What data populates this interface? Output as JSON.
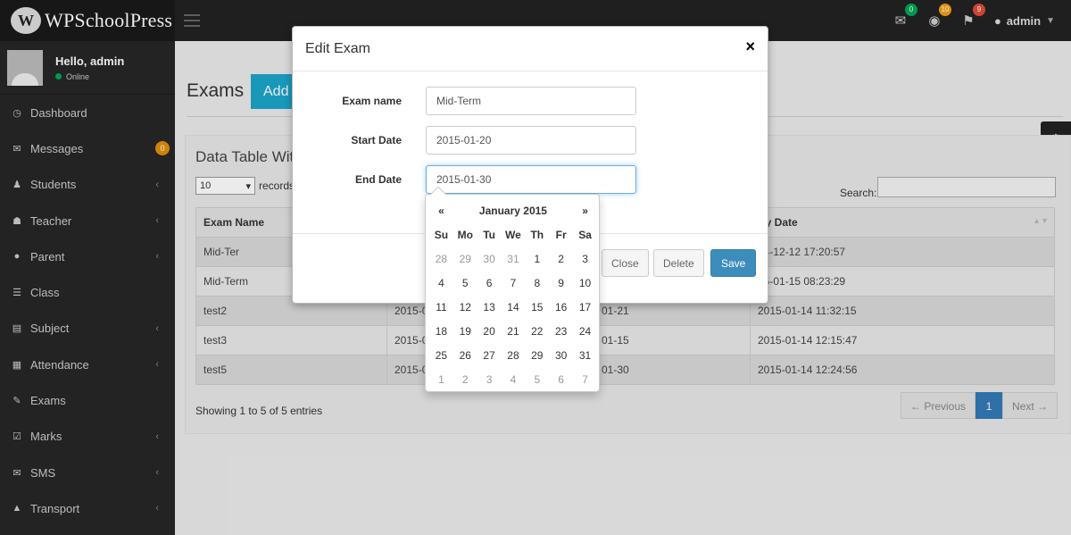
{
  "app": {
    "logo_text": "WPSchoolPress",
    "logo_mark": "W"
  },
  "header": {
    "icons": [
      {
        "name": "envelope-icon",
        "glyph": "✉",
        "badge": "0",
        "badge_color": "#00a65a"
      },
      {
        "name": "globe-icon",
        "glyph": "◉",
        "badge": "10",
        "badge_color": "#f39c12"
      },
      {
        "name": "bell-icon",
        "glyph": "🔔",
        "badge": "9",
        "badge_color": "#dd4b39"
      }
    ],
    "user": "admin"
  },
  "sidebar": {
    "greeting": "Hello, admin",
    "status": "Online",
    "items": [
      {
        "label": "Dashboard",
        "icon": "dashboard-icon",
        "glyph": "◷",
        "chevron": false
      },
      {
        "label": "Messages",
        "icon": "envelope-icon",
        "glyph": "✉",
        "chevron": false,
        "badge": "0"
      },
      {
        "label": "Students",
        "icon": "student-icon",
        "glyph": "♟",
        "chevron": true
      },
      {
        "label": "Teacher",
        "icon": "users-icon",
        "glyph": "☗",
        "chevron": true
      },
      {
        "label": "Parent",
        "icon": "user-icon",
        "glyph": "●",
        "chevron": true
      },
      {
        "label": "Class",
        "icon": "list-icon",
        "glyph": "☰",
        "chevron": false
      },
      {
        "label": "Subject",
        "icon": "book-icon",
        "glyph": "▤",
        "chevron": true
      },
      {
        "label": "Attendance",
        "icon": "table-icon",
        "glyph": "▦",
        "chevron": true
      },
      {
        "label": "Exams",
        "icon": "edit-icon",
        "glyph": "✎",
        "chevron": false
      },
      {
        "label": "Marks",
        "icon": "check-icon",
        "glyph": "☑",
        "chevron": true
      },
      {
        "label": "SMS",
        "icon": "envelope-icon",
        "glyph": "✉",
        "chevron": true
      },
      {
        "label": "Transport",
        "icon": "road-icon",
        "glyph": "▲",
        "chevron": true
      }
    ]
  },
  "page": {
    "title": "Exams",
    "add_button": "Add",
    "panel_title": "Data Table Wit",
    "records_value": "10",
    "records_label": "records",
    "search_label": "Search:",
    "table": {
      "headers": [
        "Exam Name",
        "",
        "",
        "try Date"
      ],
      "rows": [
        [
          "Mid-Ter",
          "",
          "",
          "14-12-12 17:20:57"
        ],
        [
          "Mid-Term",
          "",
          "",
          "15-01-15 08:23:29"
        ],
        [
          "test2",
          "2015-0",
          "01-21",
          "2015-01-14 11:32:15"
        ],
        [
          "test3",
          "2015-0",
          "01-15",
          "2015-01-14 12:15:47"
        ],
        [
          "test5",
          "2015-0",
          "01-30",
          "2015-01-14 12:24:56"
        ]
      ]
    },
    "showing": "Showing 1 to 5 of 5 entries",
    "pager": {
      "prev": "← Previous",
      "current": "1",
      "next": "Next →"
    }
  },
  "modal": {
    "title": "Edit Exam",
    "close": "×",
    "fields": [
      {
        "label": "Exam name",
        "value": "Mid-Term"
      },
      {
        "label": "Start Date",
        "value": "2015-01-20"
      },
      {
        "label": "End Date",
        "value": "2015-01-30"
      }
    ],
    "buttons": {
      "close": "Close",
      "delete": "Delete",
      "save": "Save"
    }
  },
  "datepicker": {
    "prev": "«",
    "title": "January 2015",
    "next": "»",
    "weekdays": [
      "Su",
      "Mo",
      "Tu",
      "We",
      "Th",
      "Fr",
      "Sa"
    ],
    "weeks": [
      [
        "28",
        "29",
        "30",
        "31",
        "1",
        "2",
        "3"
      ],
      [
        "4",
        "5",
        "6",
        "7",
        "8",
        "9",
        "10"
      ],
      [
        "11",
        "12",
        "13",
        "14",
        "15",
        "16",
        "17"
      ],
      [
        "18",
        "19",
        "20",
        "21",
        "22",
        "23",
        "24"
      ],
      [
        "25",
        "26",
        "27",
        "28",
        "29",
        "30",
        "31"
      ],
      [
        "1",
        "2",
        "3",
        "4",
        "5",
        "6",
        "7"
      ]
    ],
    "muted_weeks": [
      0,
      5
    ]
  }
}
